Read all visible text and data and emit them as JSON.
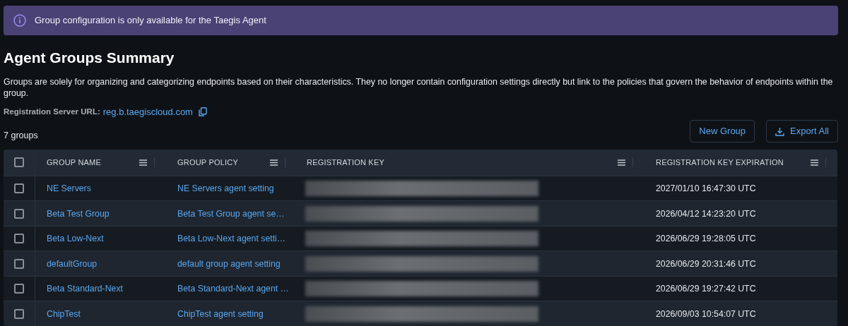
{
  "alert": {
    "text": "Group configuration is only available for the Taegis Agent"
  },
  "title": "Agent Groups Summary",
  "description": "Groups are solely for organizing and categorizing endpoints based on their characteristics. They no longer contain configuration settings directly but link to the policies that govern the behavior of endpoints within the group.",
  "registration_server": {
    "label": "Registration Server URL:",
    "url": "reg.b.taegiscloud.com"
  },
  "count": "7 groups",
  "buttons": [
    {
      "label": "New Group",
      "kind": "plain"
    },
    {
      "label": "Export All",
      "kind": "download"
    }
  ],
  "table": {
    "select_all_checked": false,
    "columns": [
      "GROUP NAME",
      "GROUP POLICY",
      "REGISTRATION KEY",
      "REGISTRATION KEY EXPIRATION"
    ],
    "rows": [
      {
        "checked": false,
        "name": "NE Servers",
        "policy": "NE Servers agent setting",
        "key_redacted": true,
        "expiration": "2027/01/10 16:47:30 UTC"
      },
      {
        "checked": false,
        "name": "Beta Test Group",
        "policy": "Beta Test Group agent se…",
        "key_redacted": true,
        "expiration": "2026/04/12 14:23:20 UTC"
      },
      {
        "checked": false,
        "name": "Beta Low-Next",
        "policy": "Beta Low-Next agent setti…",
        "key_redacted": true,
        "expiration": "2026/06/29 19:28:05 UTC"
      },
      {
        "checked": false,
        "name": "defaultGroup",
        "policy": "default group agent setting",
        "key_redacted": true,
        "expiration": "2026/06/29 20:31:46 UTC"
      },
      {
        "checked": false,
        "name": "Beta Standard-Next",
        "policy": "Beta Standard-Next agent …",
        "key_redacted": true,
        "expiration": "2026/06/29 19:27:42 UTC"
      },
      {
        "checked": false,
        "name": "ChipTest",
        "policy": "ChipTest agent setting",
        "key_redacted": true,
        "expiration": "2026/09/03 10:54:07 UTC"
      }
    ]
  }
}
